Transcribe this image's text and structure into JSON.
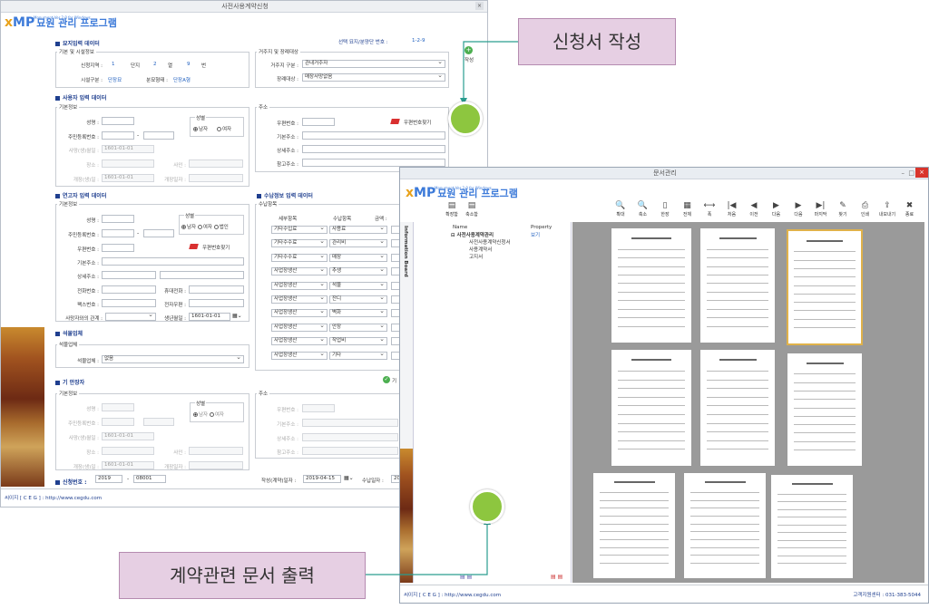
{
  "windowA": {
    "title": "사전사용계약신청",
    "close": "×",
    "logo": {
      "x": "x",
      "mp": "MP",
      "kr": "묘원 관리 프로그램",
      "sub": "Monument Ver 2.0 for Windows"
    },
    "header": {
      "sel_label": "선택 묘지/분양단 번호 :",
      "sel_value": "1-2-9"
    },
    "sec_grave": "묘지입력 데이터",
    "grp_basic_grave": "기본 및 시설정보",
    "apply_loc_label": "신청지역 :",
    "loc_values": [
      "1",
      "단지",
      "2",
      "열",
      "9",
      "번"
    ],
    "facility_label": "시설구분 :",
    "facility_value": "단장묘",
    "grave_type_label": "분묘형태 :",
    "grave_type_value": "단장A형",
    "grp_residence": "거주지 및 장례대상",
    "residence_label": "거주지 구분 :",
    "residence_value": "관내거주자",
    "funeral_label": "장례대상 :",
    "funeral_value": "매장사망없음",
    "side_label": "작성",
    "sec_user": "사용자 입력 데이터",
    "grp_user_basic": "기본정보",
    "name_label": "성명 :",
    "rrn_label": "주민등록번호 :",
    "rrn_dash": "-",
    "death_date_label": "사망(생)월일 :",
    "death_date_value": "1601-01-01",
    "place_label": "장소 :",
    "cause_label": "사인 :",
    "burial_date_label": "개장(생)일 :",
    "burial_date_value": "1601-01-01",
    "burial_place_label": "개장일자 :",
    "gender_label": "성별",
    "male": "남자",
    "female": "여자",
    "grp_address": "주소",
    "zip_label": "우편번호 :",
    "zip_search": "우편번호찾기",
    "addr_basic_label": "기본주소 :",
    "addr_detail_label": "상세주소 :",
    "addr_ref_label": "참고주소 :",
    "sec_relative": "연고자 입력 데이터",
    "grp_rel_basic": "기본정보",
    "rel_gender_other": "법인",
    "rel_phone_label": "전화번호 :",
    "rel_mobile_label": "휴대전화 :",
    "rel_fax_label": "팩스번호 :",
    "rel_email_label": "전자우편 :",
    "rel_relation_label": "사망자와의 관계 :",
    "rel_birth_label": "생년월일 :",
    "rel_birth_value": "1601-01-01",
    "sec_fee": "수납정보 입력 데이터",
    "grp_fee": "수납항목",
    "fee_headers": [
      "세부항목",
      "수납항목",
      "금액 :"
    ],
    "fee_rows": [
      {
        "a": "기타수입료",
        "b": "사용료"
      },
      {
        "a": "기타수수료",
        "b": "관리비"
      },
      {
        "a": "기타수수료",
        "b": "매장"
      },
      {
        "a": "사업장생산",
        "b": "추생"
      },
      {
        "a": "사업장생산",
        "b": "석물"
      },
      {
        "a": "사업장생산",
        "b": "잔디"
      },
      {
        "a": "사업장생산",
        "b": "벽화"
      },
      {
        "a": "사업장생산",
        "b": "안장"
      },
      {
        "a": "사업장생산",
        "b": "작업비"
      },
      {
        "a": "사업장생산",
        "b": "기타"
      }
    ],
    "sec_stone": "석물업체",
    "grp_stone": "석물업체",
    "stone_label": "석물업체 :",
    "stone_value": "없음",
    "sec_cremated": "기 안장자",
    "cre_side": "기",
    "sec_apply": "신청번호 :",
    "apply_year": "2019",
    "apply_no": "08001",
    "write_date_label": "작성(계약)일자 :",
    "write_date_value": "2019-04-15",
    "receive_label": "수납일자 :",
    "receive_value": "20",
    "footer": "씨이지 [ C E G ] : http://www.cegdu.com"
  },
  "windowB": {
    "title": "문서관리",
    "logo": {
      "x": "x",
      "mp": "MP",
      "kr": "묘원 관리 프로그램",
      "sub": "Monument Ver 2.0 for Windows"
    },
    "left_buttons": [
      "확장함",
      "축소함"
    ],
    "toolbar": [
      "확대",
      "축소",
      "한장",
      "전체",
      "폭",
      "처음",
      "이전",
      "다음",
      "다음",
      "마지막",
      "찾기",
      "인쇄",
      "내보내기",
      "종료"
    ],
    "toolbar_icons": [
      "🔍",
      "🔍",
      "▯",
      "▦",
      "⟷",
      "|◀",
      "◀",
      "▶",
      "▶",
      "▶|",
      "✎",
      "⎙",
      "⇪",
      "✖"
    ],
    "side_tab": "Information Board",
    "tree_headers": [
      "Name",
      "Property"
    ],
    "tree_root": "사전사용계약관리",
    "tree_root_prop": "보기",
    "tree_items": [
      "사전사용계약신청서",
      "사용계약서",
      "고지서"
    ],
    "footer": "씨이지 [ C E G ] : http://www.cegdu.com",
    "footer_right": "고객지원센터 : 031-383-5044"
  },
  "callouts": {
    "write": "신청서 작성",
    "print": "계약관련 문서 출력"
  },
  "colors": {
    "accent": "#8dc63f",
    "callout_bg": "#e6cfe3",
    "selected_doc": "#e0b24a"
  }
}
